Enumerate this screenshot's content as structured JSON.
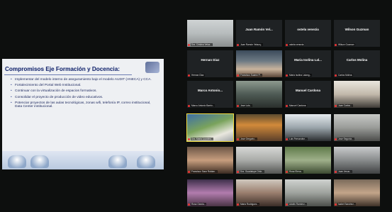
{
  "shared_screen": {
    "title": "Compromisos Eje Formación y Docencia:",
    "bullets": [
      "Implementar del modelo interno de aseguramiento bajo el modelo AUDIT (ANECA) y CCA.",
      "Fortalecimiento del Portal Web Institucional.",
      "Continuar con la virtualización de espacios formativos.",
      "Consolidar el proyecto de producción de video educativos.",
      "Potenciar proyectos de las aulas tecnológicas, zonas wifi, telefonía IP, correo institucional, Data Center institucional."
    ]
  },
  "tiles": [
    {
      "center_name": "",
      "label": "Dra. Cristina Velaz..."
    },
    {
      "center_name": "Juan Ramón Vel...",
      "label": "Juan Ramón Velazq..."
    },
    {
      "center_name": "ostela venezia",
      "label": "ostela venezia"
    },
    {
      "center_name": "Wilson Guzman",
      "label": "Wilson Guzman"
    },
    {
      "center_name": "Hernan Diaz",
      "label": "Hernan Diaz"
    },
    {
      "center_name": "",
      "label": "Francisco Suarez P..."
    },
    {
      "center_name": "Maria Isolina Lal...",
      "label": "Maria Isolina Lalang..."
    },
    {
      "center_name": "Carlos Molina",
      "label": "Carlos Molina"
    },
    {
      "center_name": "Marco Antonio...",
      "label": "Marco Antonio Barrio..."
    },
    {
      "center_name": "",
      "label": "Jose Luis..."
    },
    {
      "center_name": "Manuel Cardona",
      "label": "Manuel Cardona"
    },
    {
      "center_name": "",
      "label": "Juan Carlos..."
    },
    {
      "center_name": "",
      "label": "Dra. Maria Lourdes..."
    },
    {
      "center_name": "",
      "label": "Jose Gregorio..."
    },
    {
      "center_name": "",
      "label": "Luis Fernandez..."
    },
    {
      "center_name": "",
      "label": "Jose Segovia..."
    },
    {
      "center_name": "",
      "label": "Francisco Sanz Roldan..."
    },
    {
      "center_name": "",
      "label": "Dra. Guadalupe Ortiz..."
    },
    {
      "center_name": "",
      "label": "Rosa Elena..."
    },
    {
      "center_name": "",
      "label": "Juan Jesus..."
    },
    {
      "center_name": "",
      "label": "Rosa Garcia..."
    },
    {
      "center_name": "",
      "label": "Maria Rodriguez..."
    },
    {
      "center_name": "",
      "label": "Adolfo Ramirez..."
    },
    {
      "center_name": "",
      "label": "Isabel Sanchez..."
    }
  ],
  "colors": {
    "background": "#0d0f0e",
    "active_speaker_border": "#f4df42",
    "slide_title": "#1b2a6b",
    "muted_mic": "#e33333"
  }
}
